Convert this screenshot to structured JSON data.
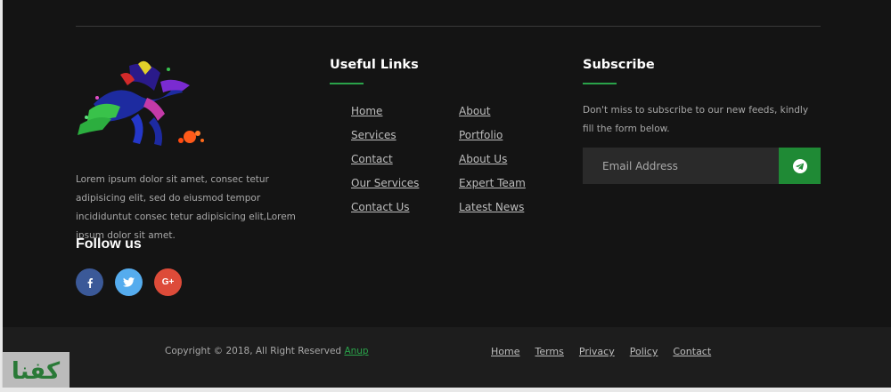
{
  "about": {
    "text": "Lorem ipsum dolor sit amet, consec tetur adipisicing elit, sed do eiusmod tempor incididuntut consec tetur adipisicing elit,Lorem ipsum dolor sit amet."
  },
  "follow": {
    "title": "Follow us",
    "icons": [
      "facebook-icon",
      "twitter-icon",
      "google-plus-icon"
    ],
    "gplus_label": "G+"
  },
  "useful_links": {
    "title": "Useful Links",
    "column_a": [
      "Home",
      "Services",
      "Contact",
      "Our Services",
      "Contact Us"
    ],
    "column_b": [
      "About",
      "Portfolio",
      "About Us",
      "Expert Team",
      "Latest News"
    ]
  },
  "subscribe": {
    "title": "Subscribe",
    "text": "Don't miss to subscribe to our new feeds, kindly fill the form below.",
    "email_placeholder": "Email Address"
  },
  "bottom": {
    "copyright": "Copyright © 2018, All Right Reserved ",
    "copyright_link": "Anup",
    "nav": [
      "Home",
      "Terms",
      "Privacy",
      "Policy",
      "Contact"
    ]
  },
  "watermark": {
    "text": "كفنا"
  },
  "colors": {
    "background": "#141414",
    "accent": "#2aa34a",
    "button": "#1f8a35",
    "facebook": "#3b5998",
    "twitter": "#55acee",
    "google_plus": "#dd4b39"
  }
}
